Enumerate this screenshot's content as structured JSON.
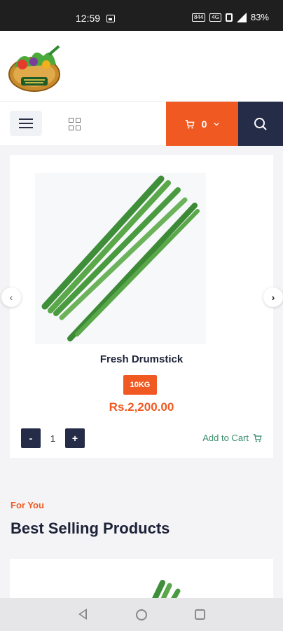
{
  "status_bar": {
    "time": "12:59",
    "network_speed": "844",
    "network_type": "4G",
    "battery": "83%"
  },
  "header": {
    "logo_icon": "vegetable-basket-logo"
  },
  "toolbar": {
    "cart_count": "0",
    "menu_icon": "hamburger-icon",
    "grid_icon": "grid-icon",
    "search_icon": "search-icon"
  },
  "product": {
    "title": "Fresh Drumstick",
    "weight": "10KG",
    "price": "Rs.2,200.00",
    "quantity": "1",
    "minus_label": "-",
    "plus_label": "+",
    "add_to_cart_label": "Add to Cart"
  },
  "carousel": {
    "prev_label": "‹",
    "next_label": "›"
  },
  "section": {
    "kicker": "For You",
    "title": "Best Selling Products"
  },
  "colors": {
    "accent": "#f05a22",
    "navy": "#252c48",
    "green": "#3d8f6e"
  }
}
